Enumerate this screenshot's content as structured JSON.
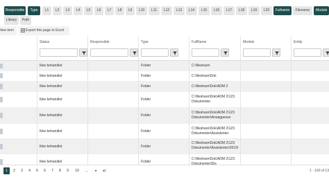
{
  "topbar": {
    "buttons": [
      {
        "label": "Responsible",
        "active": true
      },
      {
        "label": "Type",
        "active": true
      },
      {
        "label": "L1",
        "active": false
      },
      {
        "label": "L2",
        "active": false
      },
      {
        "label": "L3",
        "active": false
      },
      {
        "label": "L4",
        "active": false
      },
      {
        "label": "L5",
        "active": false
      },
      {
        "label": "L6",
        "active": false
      },
      {
        "label": "L7",
        "active": false
      },
      {
        "label": "L8",
        "active": false
      },
      {
        "label": "L9",
        "active": false
      },
      {
        "label": "L10",
        "active": false
      },
      {
        "label": "L11",
        "active": false
      },
      {
        "label": "L12",
        "active": false
      },
      {
        "label": "L13",
        "active": false
      },
      {
        "label": "L14",
        "active": false
      },
      {
        "label": "L15",
        "active": false
      },
      {
        "label": "L16",
        "active": false
      },
      {
        "label": "L17",
        "active": false
      },
      {
        "label": "L18",
        "active": false
      },
      {
        "label": "L19",
        "active": false
      },
      {
        "label": "L20",
        "active": false
      },
      {
        "label": "Fullname",
        "active": true
      },
      {
        "label": "Filename",
        "active": false
      },
      {
        "label": "Module",
        "active": true
      }
    ],
    "row2": [
      {
        "label": "Library",
        "active": false
      },
      {
        "label": "Path",
        "active": false
      }
    ]
  },
  "toolbar": {
    "new_item": "New item",
    "export": "Export this page to Excel"
  },
  "grid": {
    "columns": [
      "Status",
      "Responsible",
      "Type",
      "FullName",
      "Module",
      "Entity"
    ],
    "rows": [
      {
        "status": "Ikke behandlet",
        "type": "Folder",
        "fullname": "C:\\fileshare\\"
      },
      {
        "status": "Ikke behandlet",
        "type": "Folder",
        "fullname": "C:\\fileshare\\Dok"
      },
      {
        "status": "Ikke behandlet",
        "type": "Folder",
        "fullname": "C:\\fileshare\\Dok\\ADM 2"
      },
      {
        "status": "Ikke behandlet",
        "type": "Folder",
        "fullname": "C:\\fileshare\\Dok\\ADM 2\\123\nDokumenter"
      },
      {
        "status": "Ikke behandlet",
        "type": "Folder",
        "fullname": "C:\\fileshare\\Dok\\ADM 2\\123\nDokumenter\\Ansøgpesse"
      },
      {
        "status": "Ikke behandlet",
        "type": "Folder",
        "fullname": "C:\\fileshare\\Dok\\ADM 2\\123\nDokumenter\\Assistenter"
      },
      {
        "status": "Ikke behandlet",
        "type": "Folder",
        "fullname": "C:\\fileshare\\Dok\\ADM 2\\123\nDokumenter\\Assistenter\\2019\\"
      },
      {
        "status": "Ikke behandlet",
        "type": "Folder",
        "fullname": "C:\\fileshare\\Dok\\ADM 2\\123\nDokumenter\\Dis"
      }
    ]
  },
  "pagination": {
    "pages": [
      "1",
      "2",
      "3",
      "4",
      "5",
      "6",
      "7",
      "8",
      "9",
      "10",
      "...",
      "▸",
      "▸|"
    ],
    "info": "1 - 100 of 13"
  },
  "colors": {
    "accent": "#1f4d4d",
    "stripe": "#f0f0f0"
  }
}
